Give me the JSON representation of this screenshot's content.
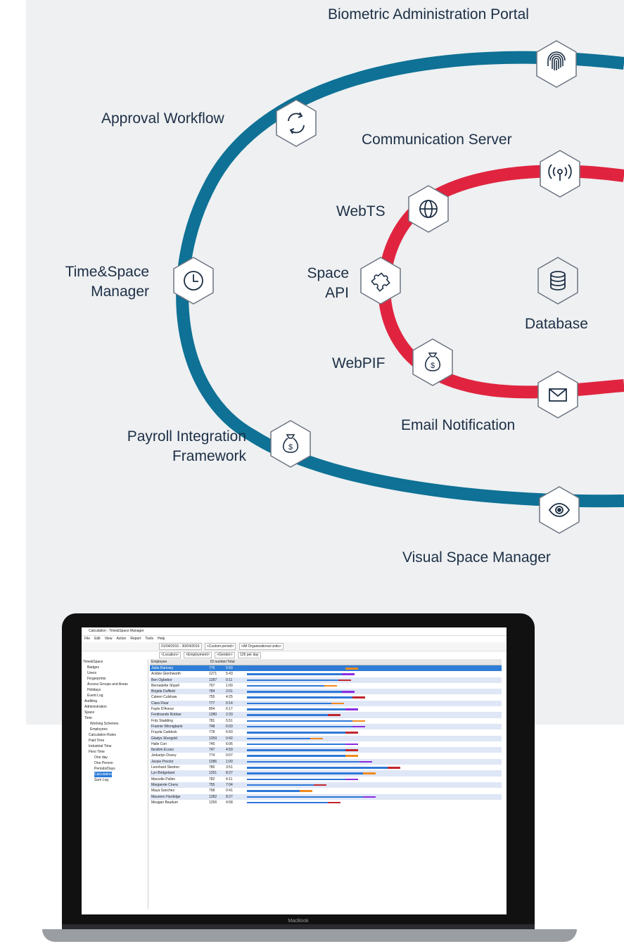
{
  "diagram": {
    "nodes": {
      "biometric": "Biometric Administration Portal",
      "approval": "Approval Workflow",
      "communication": "Communication Server",
      "webts": "WebTS",
      "timespace_1": "Time&Space",
      "timespace_2": "Manager",
      "spaceapi_1": "Space",
      "spaceapi_2": "API",
      "database": "Database",
      "webpif": "WebPIF",
      "email": "Email Notification",
      "payroll_1": "Payroll Integration",
      "payroll_2": "Framework",
      "visual": "Visual Space Manager"
    },
    "icons": {
      "biometric": "fingerprint-icon",
      "approval": "refresh-cycle-icon",
      "communication": "broadcast-icon",
      "webts": "globe-icon",
      "timespace": "clock-icon",
      "spaceapi": "puzzle-icon",
      "database": "database-icon",
      "webpif": "money-bag-icon",
      "email": "envelope-icon",
      "payroll": "money-bag-icon",
      "visual": "eye-icon"
    },
    "colors": {
      "outer_ring": "#0e7195",
      "inner_ring": "#e0243f",
      "background": "#eef0f2",
      "text": "#1d2f45"
    }
  },
  "laptop": {
    "brand": "MacBook",
    "window_title": "Calculation - Time&Space Manager",
    "menu": [
      "File",
      "Edit",
      "View",
      "Action",
      "Report",
      "Tools",
      "Help"
    ],
    "date_range": "01/04/2016 - 30/04/2016",
    "custom_period": "<Custom period>",
    "org_units": "<All Organizational units>",
    "location": "<Location>",
    "employment": "<Employment>",
    "gender": "<Gender>",
    "per_day": "12h per day",
    "tree": [
      "Time&Space",
      "Badges",
      "Users",
      "Fingerprints",
      "Access Groups and Areas",
      "Holidays",
      "Event Log",
      "Auditing",
      "Administration",
      "Space",
      "Time",
      "Working Schemes",
      "Employees",
      "Calculation Rules",
      "Paid Time",
      "Industrial Time",
      "Flexi Time",
      "One day",
      "One Person",
      "Periods/Days",
      "Calculation",
      "Sum Log"
    ],
    "columns": [
      "Employee",
      "ID number",
      "Total"
    ],
    "rows": [
      {
        "name": "Jiulia Ramsey",
        "id": "776",
        "total": "5:50"
      },
      {
        "name": "Ackbie Glenhworth",
        "id": "1271",
        "total": "5:43"
      },
      {
        "name": "Ben Ogbebor",
        "id": "1287",
        "total": "0:11"
      },
      {
        "name": "Bernadette Shpell",
        "id": "757",
        "total": "1:00"
      },
      {
        "name": "Brigida Duffield",
        "id": "784",
        "total": "2:01"
      },
      {
        "name": "Caleen Culshaw",
        "id": "755",
        "total": "4:25"
      },
      {
        "name": "Ciara Flear",
        "id": "777",
        "total": "0:14"
      },
      {
        "name": "Fayle D'Aveux",
        "id": "804",
        "total": "6:17"
      },
      {
        "name": "Ferdinando Roblan",
        "id": "1280",
        "total": "2:33"
      },
      {
        "name": "Fritz Stadding",
        "id": "781",
        "total": "5:51"
      },
      {
        "name": "Frannie Winnigbank",
        "id": "748",
        "total": "6:03"
      },
      {
        "name": "Frayda Caddock",
        "id": "778",
        "total": "6:50"
      },
      {
        "name": "Gladys Shergold",
        "id": "1259",
        "total": "0:42"
      },
      {
        "name": "Halle Cori",
        "id": "745",
        "total": "6:06"
      },
      {
        "name": "Ibrahim Ecoso",
        "id": "747",
        "total": "4:59"
      },
      {
        "name": "Jeduelyn Dovey",
        "id": "774",
        "total": "0:07"
      },
      {
        "name": "Jessie Proctor",
        "id": "1286",
        "total": "1:00"
      },
      {
        "name": "Leonhard Stedron",
        "id": "785",
        "total": "3:51"
      },
      {
        "name": "Lyn Bridgeland",
        "id": "1251",
        "total": "8:27"
      },
      {
        "name": "Marcelle Pullen",
        "id": "782",
        "total": "4:11"
      },
      {
        "name": "Margarete Cirera",
        "id": "755",
        "total": "7:04"
      },
      {
        "name": "Maya Sanchez",
        "id": "758",
        "total": "0:41"
      },
      {
        "name": "Maureen Hurdidge",
        "id": "1282",
        "total": "8:27"
      },
      {
        "name": "Meagan Baudum",
        "id": "1256",
        "total": "4:58"
      }
    ]
  }
}
